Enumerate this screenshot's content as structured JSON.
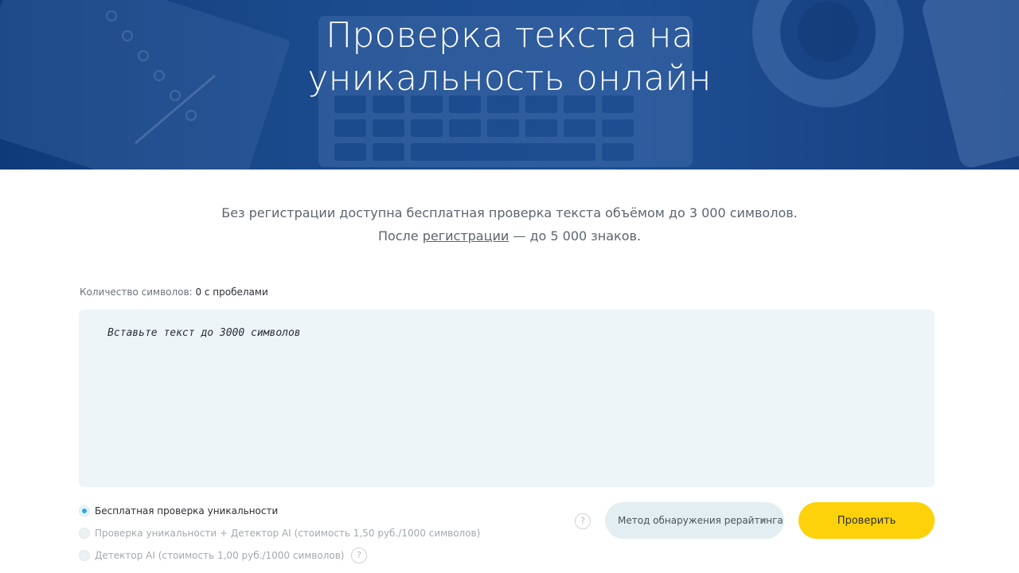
{
  "hero": {
    "title_line1": "Проверка текста на",
    "title_line2": "уникальность онлайн"
  },
  "intro": {
    "line1": "Без регистрации доступна бесплатная проверка текста объёмом до 3 000 символов.",
    "line2_prefix": "После ",
    "line2_link": "регистрации",
    "line2_suffix": " — до 5 000 знаков."
  },
  "counter": {
    "label": "Количество символов:",
    "value": "0 с пробелами"
  },
  "editor": {
    "placeholder": "Вставьте текст до 3000 символов"
  },
  "options": [
    {
      "label": "Бесплатная проверка уникальности",
      "selected": true
    },
    {
      "label": "Проверка уникальности + Детектор AI (стоимость 1,50 руб./1000 символов)",
      "selected": false
    },
    {
      "label": "Детектор AI (стоимость 1,00 руб./1000 символов)",
      "selected": false
    }
  ],
  "help": {
    "symbol": "?"
  },
  "method": {
    "label": "Метод обнаружения рерайтинга"
  },
  "actions": {
    "check_label": "Проверить"
  },
  "colors": {
    "hero_blue": "#1b4a8c",
    "editor_bg": "#eef5f9",
    "accent_yellow": "#fdd20a",
    "radio_blue": "#33a8df"
  }
}
